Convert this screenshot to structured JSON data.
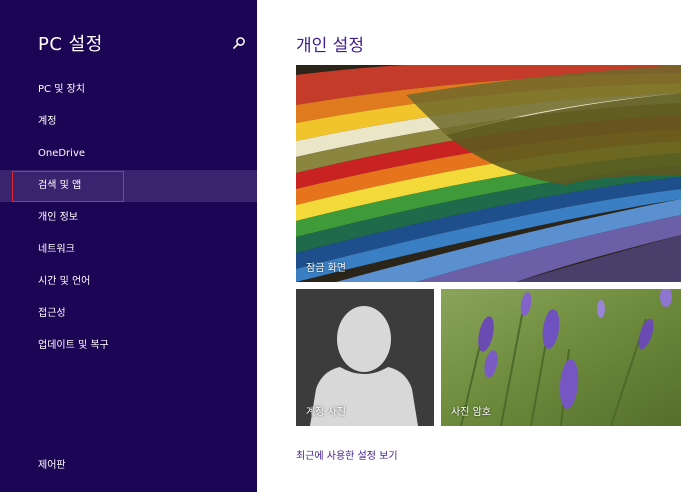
{
  "sidebar": {
    "title": "PC 설정",
    "search_icon": "search-icon",
    "items": [
      {
        "label": "PC 및 장치"
      },
      {
        "label": "계정"
      },
      {
        "label": "OneDrive"
      },
      {
        "label": "검색 및 앱",
        "selected": true
      },
      {
        "label": "개인 정보"
      },
      {
        "label": "네트워크"
      },
      {
        "label": "시간 및 언어"
      },
      {
        "label": "접근성"
      },
      {
        "label": "업데이트 및 복구"
      }
    ],
    "footer": "제어판"
  },
  "main": {
    "title": "개인 설정",
    "tiles": {
      "lock_screen": "잠금 화면",
      "account_picture": "계정 사진",
      "picture_password": "사진 암호"
    },
    "recent_link": "최근에 사용한 설정 보기"
  },
  "colors": {
    "sidebar_bg": "#1c0555",
    "selected_bg": "#3a2470",
    "accent": "#3f1c8f",
    "focus_border": "#e1262c"
  }
}
